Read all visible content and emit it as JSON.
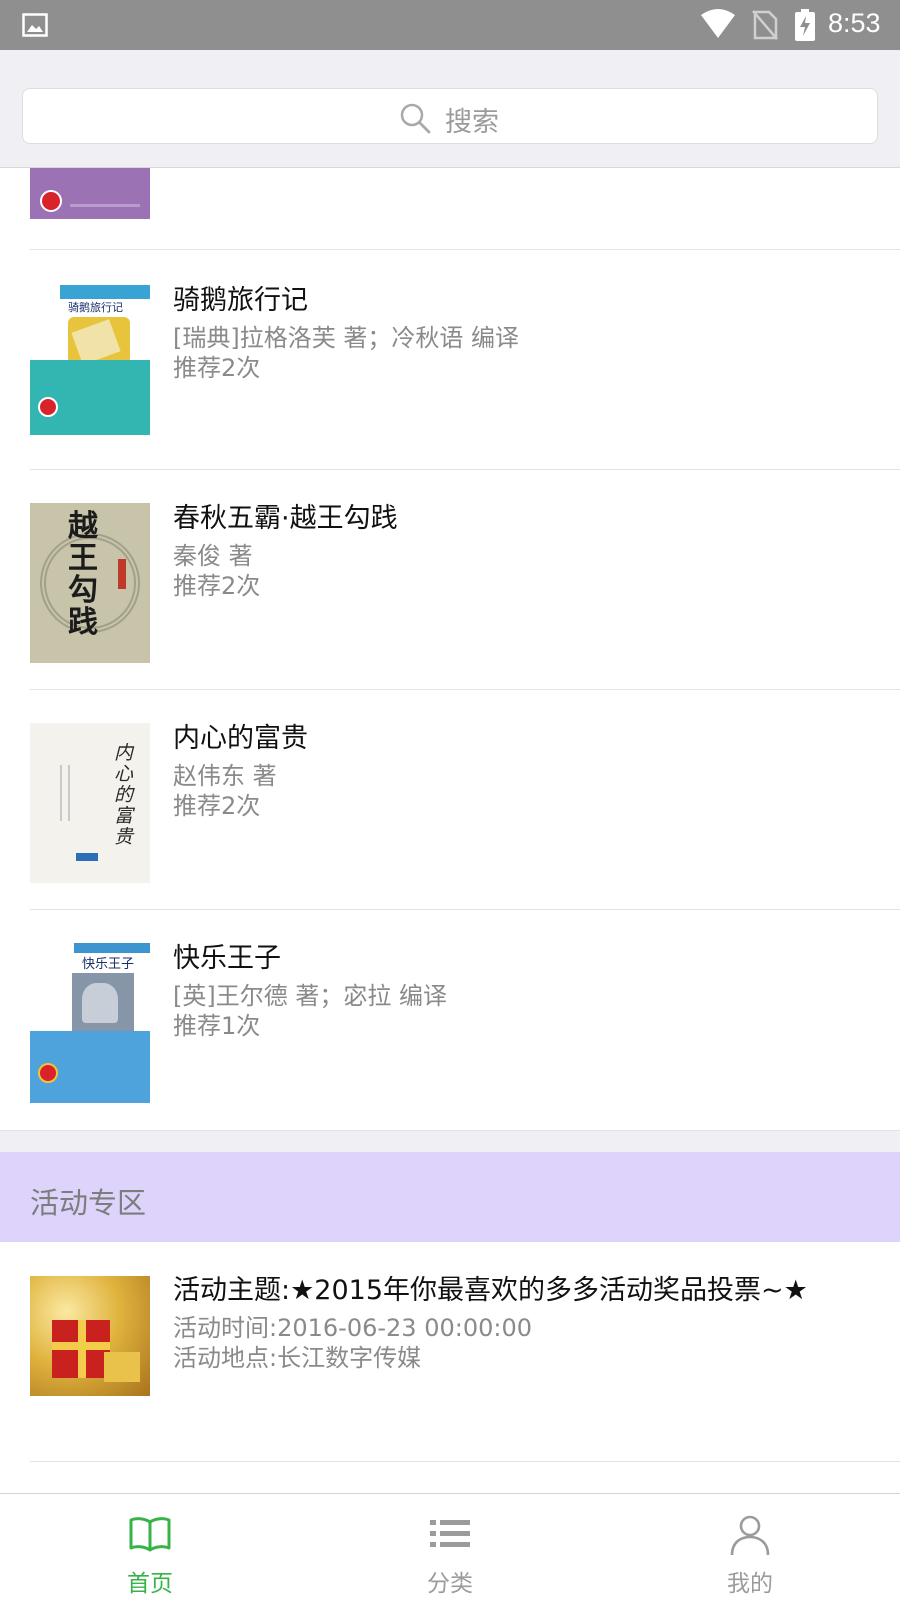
{
  "status_bar": {
    "time": "8:53"
  },
  "search": {
    "label": "搜索"
  },
  "books": [
    {
      "title": "骑鹅旅行记",
      "author": "[瑞典]拉格洛芙 著；冷秋语 编译",
      "recommend": "推荐2次",
      "cover_text": "骑鹅旅行记"
    },
    {
      "title": "春秋五霸·越王勾践",
      "author": "秦俊 著",
      "recommend": "推荐2次",
      "cover_text": "越王勾践"
    },
    {
      "title": "内心的富贵",
      "author": "赵伟东 著",
      "recommend": "推荐2次",
      "cover_text": "内心的富贵"
    },
    {
      "title": "快乐王子",
      "author": "[英]王尔德 著；宓拉 编译",
      "recommend": "推荐1次",
      "cover_text": "快乐王子"
    }
  ],
  "activity_section": {
    "title": "活动专区",
    "items": [
      {
        "theme": "活动主题:★2015年你最喜欢的多多活动奖品投票~★",
        "time": "活动时间:2016-06-23 00:00:00",
        "place": "活动地点:长江数字传媒"
      }
    ]
  },
  "tabs": [
    {
      "label": "首页",
      "icon": "book-open-icon",
      "active": true
    },
    {
      "label": "分类",
      "icon": "list-icon",
      "active": false
    },
    {
      "label": "我的",
      "icon": "person-icon",
      "active": false
    }
  ],
  "colors": {
    "accent": "#37b34a",
    "tab_inactive": "#9b9b9b",
    "activity_header_bg": "#ddd3fb",
    "status_bar_bg": "#8f8f8f"
  }
}
